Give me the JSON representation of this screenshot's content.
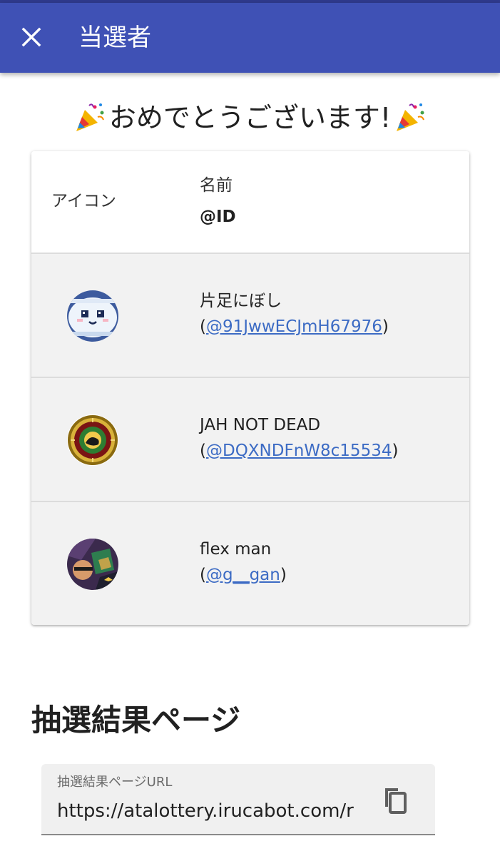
{
  "appbar": {
    "title": "当選者",
    "close_icon": "close-icon"
  },
  "congrats": {
    "message": "おめでとうございます!",
    "icon": "party-popper-icon"
  },
  "table": {
    "header": {
      "icon_label": "アイコン",
      "name_label": "名前",
      "id_label": "@ID"
    },
    "rows": [
      {
        "name": "片足にぼし",
        "open": "(",
        "handle": "@91JwwECJmH67976",
        "close": ")",
        "avatar": "white-blob-face-avatar"
      },
      {
        "name": "JAH NOT DEAD",
        "open": "(",
        "handle": "@DQXNDFnW8c15534",
        "close": ")",
        "avatar": "lion-emblem-avatar"
      },
      {
        "name": "flex man",
        "open": "(",
        "handle": "@g__gan",
        "close": ")",
        "avatar": "comic-art-avatar"
      }
    ]
  },
  "result_section": {
    "title": "抽選結果ページ",
    "url_field_label": "抽選結果ページURL",
    "url_value": "https://atalottery.irucabot.com/r",
    "copy_icon": "copy-icon"
  },
  "colors": {
    "appbar": "#3f51b5",
    "link": "#3c6bc4",
    "row_background": "#f2f2f2"
  }
}
